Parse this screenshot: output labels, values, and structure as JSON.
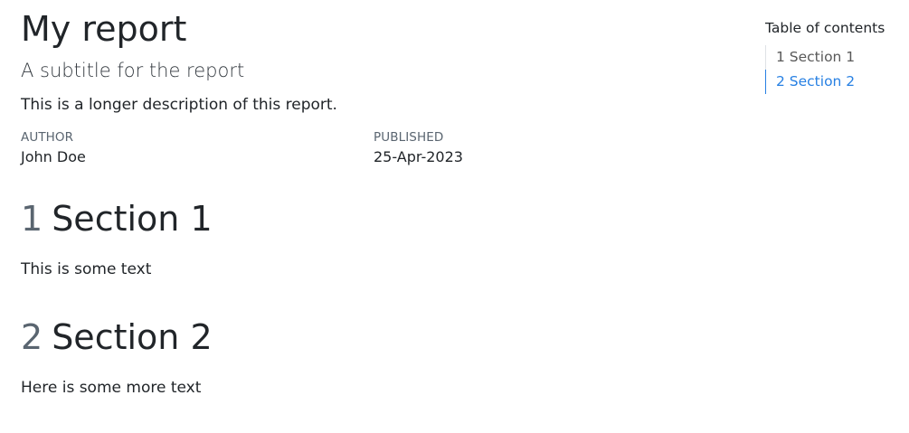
{
  "report": {
    "title": "My report",
    "subtitle": "A subtitle for the report",
    "description": "This is a longer description of this report."
  },
  "meta": {
    "author_heading": "AUTHOR",
    "author_value": "John Doe",
    "published_heading": "PUBLISHED",
    "published_value": "25-Apr-2023"
  },
  "sections": [
    {
      "number": "1",
      "title": "Section 1",
      "text": "This is some text"
    },
    {
      "number": "2",
      "title": "Section 2",
      "text": "Here is some more text"
    }
  ],
  "toc": {
    "title": "Table of contents",
    "items": [
      {
        "label": "1 Section 1",
        "active": false
      },
      {
        "label": "2 Section 2",
        "active": true
      }
    ],
    "active_color": "#2780e3"
  }
}
